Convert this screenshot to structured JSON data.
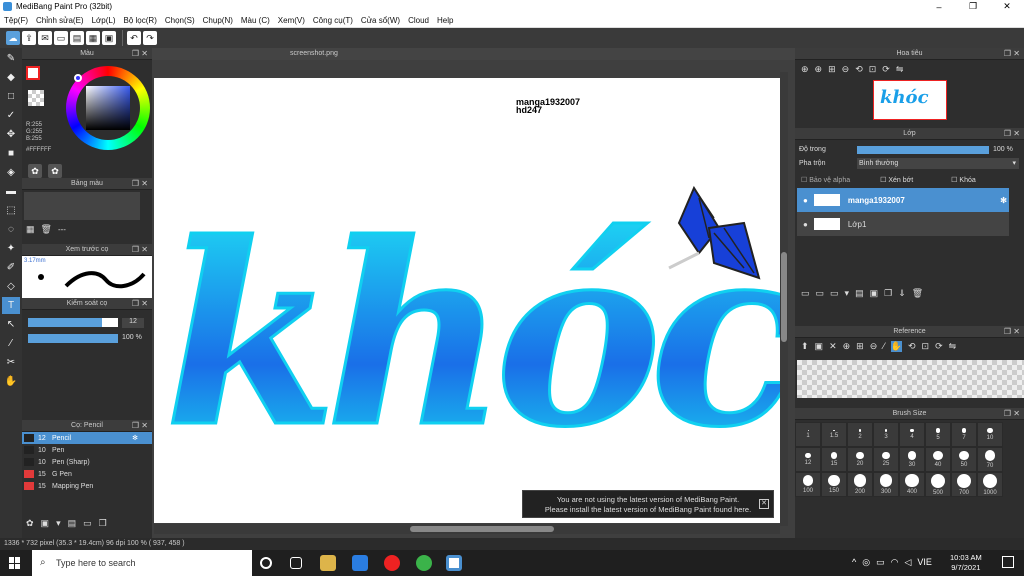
{
  "window": {
    "title": "MediBang Paint Pro (32bit)",
    "minimize": "–",
    "maximize": "❐",
    "close": "✕"
  },
  "menu": [
    "Tệp(F)",
    "Chỉnh sửa(E)",
    "Lớp(L)",
    "Bộ lọc(R)",
    "Chọn(S)",
    "Chụp(N)",
    "Màu (C)",
    "Xem(V)",
    "Công cụ(T)",
    "Cửa sổ(W)",
    "Cloud",
    "Help"
  ],
  "document": {
    "tab": "screenshot.png",
    "watermark_line1": "manga1932007",
    "watermark_line2": "hd247",
    "art_text": "khóc"
  },
  "color_panel": {
    "title": "Màu",
    "r": "R:255",
    "g": "G:255",
    "b": "B:255",
    "hex": "#FFFFFF"
  },
  "palette_panel": {
    "title": "Bảng màu",
    "dash": "---"
  },
  "brush_preview": {
    "title": "Xem trước cọ",
    "size": "3.17mm"
  },
  "brush_control": {
    "title": "Kiểm soát cọ",
    "size_value": "12",
    "opacity_value": "100 %",
    "size_fraction": 0.82,
    "opacity_fraction": 1.0
  },
  "brush_list": {
    "title": "Cọ: Pencil",
    "items": [
      {
        "size": "12",
        "name": "Pencil",
        "color": "#222222",
        "selected": true
      },
      {
        "size": "10",
        "name": "Pen",
        "color": "#222222",
        "selected": false
      },
      {
        "size": "10",
        "name": "Pen (Sharp)",
        "color": "#222222",
        "selected": false
      },
      {
        "size": "15",
        "name": "G Pen",
        "color": "#e23a3a",
        "selected": false
      },
      {
        "size": "15",
        "name": "Mapping Pen",
        "color": "#e23a3a",
        "selected": false
      }
    ]
  },
  "navigator": {
    "title": "Hoa tiêu"
  },
  "layer_panel": {
    "title": "Lớp",
    "opacity_label": "Độ trong",
    "opacity_value": "100 %",
    "blend_label": "Pha trộn",
    "blend_value": "Bình thường",
    "protect_alpha": "Bảo vệ alpha",
    "clipping": "Xén bớt",
    "lock": "Khóa",
    "layers": [
      {
        "name": "manga1932007",
        "selected": true
      },
      {
        "name": "Lớp1",
        "selected": false
      }
    ]
  },
  "reference_panel": {
    "title": "Reference"
  },
  "brush_size_panel": {
    "title": "Brush Size",
    "sizes": [
      "1",
      "1.5",
      "2",
      "3",
      "4",
      "5",
      "7",
      "10",
      "12",
      "15",
      "20",
      "25",
      "30",
      "40",
      "50",
      "70",
      "100",
      "150",
      "200",
      "300",
      "400",
      "500",
      "700",
      "1000"
    ]
  },
  "notification": {
    "line1": "You are not using the latest version of MediBang Paint.",
    "line2": "Please install the latest version of MediBang Paint found here.",
    "close": "✕"
  },
  "status": {
    "text": "1336 * 732 pixel  (35.3 * 19.4cm)  96 dpi  100 %  ( 937, 458 )"
  },
  "taskbar": {
    "search_placeholder": "Type here to search",
    "time": "10:03 AM",
    "date": "9/7/2021",
    "lang": "VIE"
  },
  "colors": {
    "accent": "#4a90d0",
    "art_light": "#1ee8f5",
    "art_dark": "#1a6fe8",
    "leaf": "#1740d8"
  }
}
